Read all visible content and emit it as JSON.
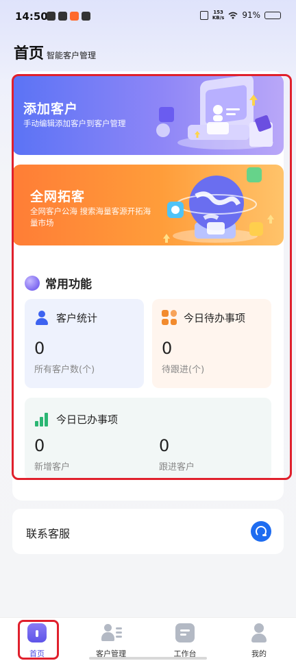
{
  "status_bar": {
    "time": "14:50",
    "net_speed_value": "153",
    "net_speed_unit": "KB/s",
    "battery": "91%"
  },
  "header": {
    "title": "首页",
    "subtitle": "智能客户管理"
  },
  "banners": {
    "add_customer": {
      "title": "添加客户",
      "desc": "手动编辑添加客户到客户管理"
    },
    "network_prospect": {
      "title": "全网拓客",
      "desc": "全网客户公海 搜索海量客源开拓海量市场"
    }
  },
  "common_functions": {
    "title": "常用功能",
    "customer_stats": {
      "label": "客户统计",
      "value": "0",
      "sub": "所有客户数(个)"
    },
    "today_todo": {
      "label": "今日待办事项",
      "value": "0",
      "sub": "待跟进(个)"
    },
    "today_done": {
      "label": "今日已办事项",
      "new_value": "0",
      "new_label": "新增客户",
      "follow_value": "0",
      "follow_label": "跟进客户"
    }
  },
  "contact": {
    "label": "联系客服",
    "icon": "headset-icon"
  },
  "tabbar": {
    "home": "首页",
    "customers": "客户管理",
    "workbench": "工作台",
    "mine": "我的"
  },
  "colors": {
    "highlight": "#e0202c",
    "accent": "#5e54e8",
    "add_banner": "#5b73f5",
    "net_banner": "#ff7d36"
  }
}
